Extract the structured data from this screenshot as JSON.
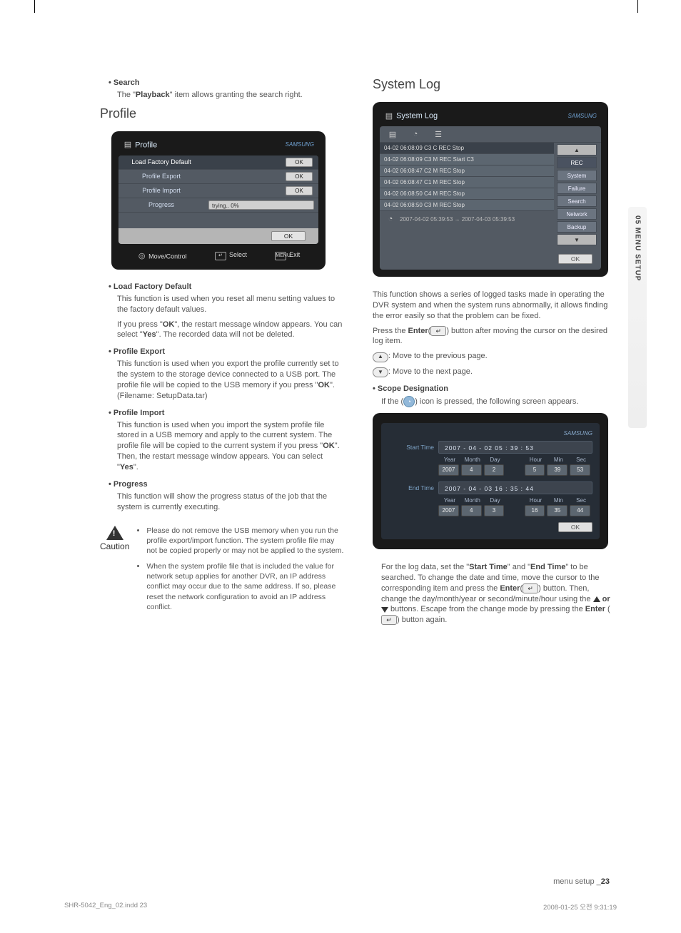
{
  "tab": {
    "label": "05 MENU SETUP"
  },
  "left": {
    "search_head": "Search",
    "search_text_pre": "The \"",
    "search_bold": "Playback",
    "search_text_post": "\" item allows granting the search right.",
    "profile_heading": "Profile",
    "ui": {
      "title": "Profile",
      "rows": [
        {
          "label": "Load Factory Default",
          "btn": "OK"
        },
        {
          "label": "Profile Export",
          "btn": "OK"
        },
        {
          "label": "Profile Import",
          "btn": "OK"
        },
        {
          "label": "Progress",
          "field": "trying.. 0%"
        }
      ],
      "ok": "OK",
      "footer": {
        "move": "Move/Control",
        "select": "Select",
        "exit": "Exit",
        "menu_key": "MENU"
      }
    },
    "lfd_head": "Load Factory Default",
    "lfd_p1": "This function is used when you reset all menu setting values to the factory default values.",
    "lfd_p2_a": "If you press \"",
    "lfd_p2_ok": "OK",
    "lfd_p2_b": "\", the restart message window appears. You can select \"",
    "lfd_p2_yes": "Yes",
    "lfd_p2_c": "\". The recorded data will not be deleted.",
    "pexp_head": "Profile Export",
    "pexp_a": "This function is used when you export the profile currently set to the system to the storage device connected to a USB port. The profile file will be copied to the USB memory if you press \"",
    "pexp_ok": "OK",
    "pexp_b": "\". (Filename: SetupData.tar)",
    "pimp_head": "Profile Import",
    "pimp_a": "This function is used when you import the system profile file stored in a USB memory and apply to the current system. The profile file will be copied to the current system if you press \"",
    "pimp_ok": "OK",
    "pimp_b": "\". Then, the restart message window appears. You can select \"",
    "pimp_yes": "Yes",
    "pimp_c": "\".",
    "prog_head": "Progress",
    "prog_text": "This function will show the progress status of the job that the system is currently executing.",
    "caution_label": "Caution",
    "caution_items": [
      "Please do not remove the USB memory when you run the profile export/import function. The system profile file may not be copied properly or may not be applied to the system.",
      "When the system profile file that is included the value for network setup applies for another DVR, an IP address conflict may occur due to the same address. If so, please reset the network configuration to avoid an IP address conflict."
    ]
  },
  "right": {
    "syslog_heading": "System Log",
    "log_ui": {
      "title": "System Log",
      "lines": [
        "04-02  06:08:09  C3  C   REC   Stop",
        "04-02  06:08:09  C3  M   REC   Start C3",
        "04-02  06:08:47  C2  M   REC   Stop",
        "04-02  06:08:47  C1  M   REC   Stop",
        "04-02  06:08:50  C4  M   REC   Stop",
        "04-02  06:08:50  C3  M   REC   Stop"
      ],
      "status": "2007-04-02 05:39:53 → 2007-04-03 05:39:53",
      "side": [
        "REC",
        "System",
        "Failure",
        "Search",
        "Network",
        "Backup"
      ],
      "ok": "OK"
    },
    "desc_a": "This function shows a series of logged tasks made in operating the DVR system and when the system runs abnormally, it allows finding the error easily so that the problem can be fixed.",
    "desc_b_pre": "Press the ",
    "desc_b_bold": "Enter",
    "desc_b_post": " button after moving the cursor on the desired log item.",
    "prev": ": Move to the previous page.",
    "next": ": Move to the next page.",
    "scope_head": "Scope Designation",
    "scope_intro_a": "If the (",
    "scope_intro_b": ") icon is pressed, the following screen appears.",
    "scope_ui": {
      "brand": "SAMSUNG",
      "start_label": "Start Time",
      "start_dt": "2007 - 04 - 02     05 : 39 : 53",
      "end_label": "End Time",
      "end_dt": "2007 - 04 - 03     16 : 35 : 44",
      "cols": [
        "Year",
        "Month",
        "Day",
        "Hour",
        "Min",
        "Sec"
      ],
      "start_vals": [
        "2007",
        "4",
        "2",
        "5",
        "39",
        "53"
      ],
      "end_vals": [
        "2007",
        "4",
        "3",
        "16",
        "35",
        "44"
      ],
      "ok": "OK"
    },
    "scope_desc_1a": "For the log data, set the \"",
    "scope_desc_1b": "Start Time",
    "scope_desc_1c": "\" and \"",
    "scope_desc_1d": "End Time",
    "scope_desc_1e": "\" to be searched. To change the date and time, move the cursor to the corresponding item and press the ",
    "scope_desc_enter": "Enter",
    "scope_desc_1f": " button. Then, change the day/month/year or second/minute/hour using the ",
    "scope_desc_or": " or ",
    "scope_desc_1g": " buttons. Escape from the change mode by pressing the ",
    "scope_desc_1h": " button again."
  },
  "footer": {
    "file": "SHR-5042_Eng_02.indd   23",
    "timestamp": "2008-01-25   오전 9:31:19",
    "crumb": "menu setup _",
    "pageno": "23"
  }
}
